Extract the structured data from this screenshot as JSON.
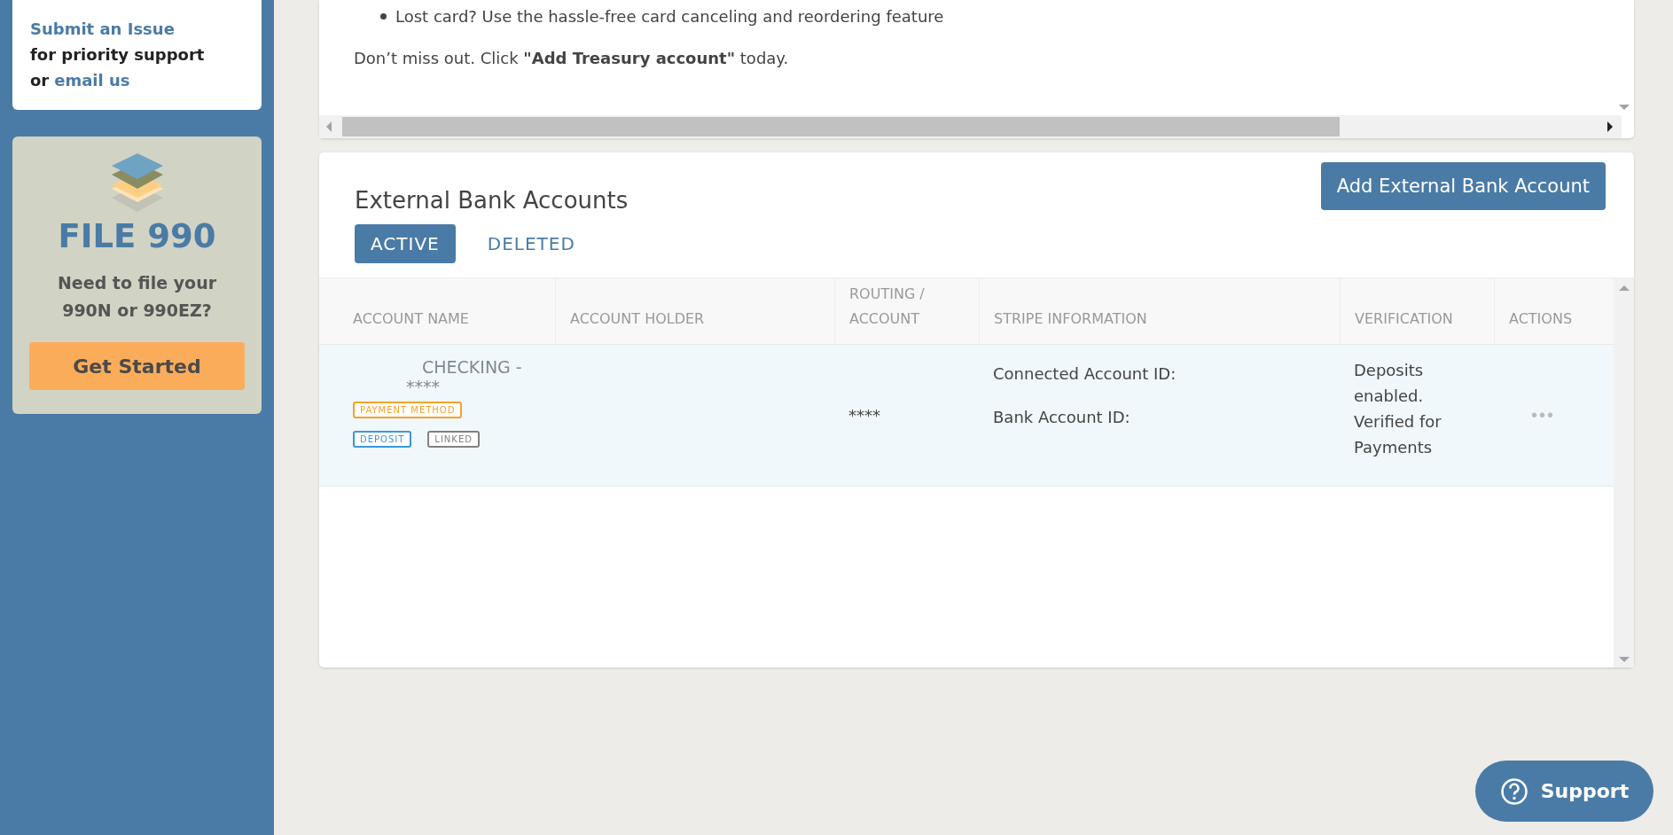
{
  "sidebar": {
    "support_card": {
      "submit_link": "Submit an Issue",
      "text": "for priority support",
      "or": "or",
      "email_link": "email us"
    },
    "promo": {
      "title": "FILE 990",
      "text": "Need to file your 990N or 990EZ?",
      "button": "Get Started"
    }
  },
  "treasury_panel": {
    "bullets": [
      "Lost card? Use the hassle-free card canceling and reordering feature"
    ],
    "cta": "Don’t miss out. Click **\"Add Treasury account\"** today."
  },
  "bank_accounts": {
    "title": "External Bank Accounts",
    "add_button": "Add External Bank Account",
    "tabs": [
      {
        "label": "ACTIVE",
        "selected": true
      },
      {
        "label": "DELETED",
        "selected": false
      }
    ],
    "columns": [
      "ACCOUNT NAME",
      "ACCOUNT HOLDER",
      "ROUTING / ACCOUNT",
      "STRIPE INFORMATION",
      "VERIFICATION",
      "ACTIONS"
    ],
    "rows": [
      {
        "name": "CHECKING -",
        "number": "****",
        "badges": [
          {
            "label": "PAYMENT METHOD",
            "color": "#f7a12a"
          },
          {
            "label": "DEPOSIT",
            "color": "#3a97d8"
          },
          {
            "label": "LINKED",
            "color": "#808080"
          }
        ],
        "routing": "****",
        "stripe": [
          "Connected Account ID:",
          "Bank Account ID:"
        ],
        "verification": "Deposits enabled. Verified for Payments",
        "actions": "•••"
      }
    ]
  },
  "support_button": "Support"
}
